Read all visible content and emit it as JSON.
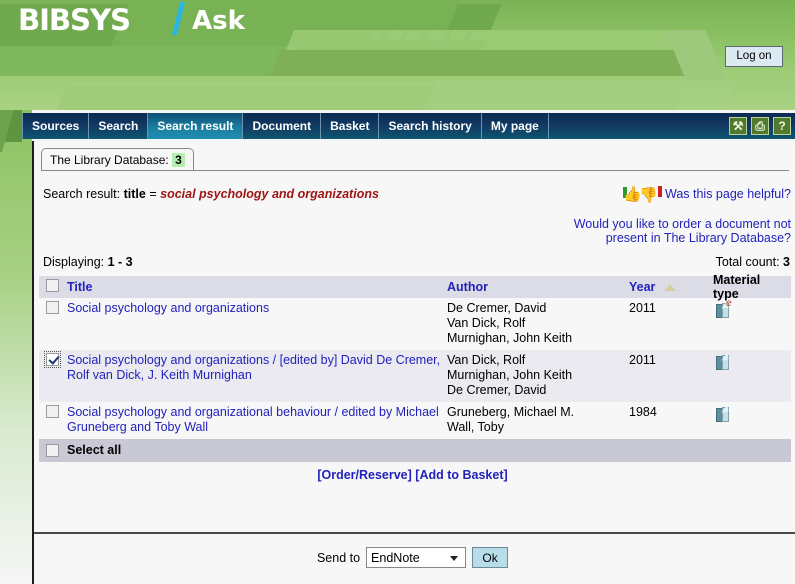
{
  "banner": {
    "logo": "BIBSYS",
    "app_name": "Ask",
    "logon_label": "Log on",
    "accent_cyan": "#29b6e0",
    "green": "#8cc162"
  },
  "nav": {
    "tabs": [
      {
        "label": "Sources",
        "active": false
      },
      {
        "label": "Search",
        "active": false
      },
      {
        "label": "Search result",
        "active": true
      },
      {
        "label": "Document",
        "active": false
      },
      {
        "label": "Basket",
        "active": false
      },
      {
        "label": "Search history",
        "active": false
      },
      {
        "label": "My page",
        "active": false
      }
    ],
    "icons": [
      {
        "name": "wrench-icon",
        "glyph": "⚒"
      },
      {
        "name": "printer-icon",
        "glyph": "⎙"
      },
      {
        "name": "help-icon",
        "glyph": "?"
      }
    ]
  },
  "database_tab": {
    "label": "The Library Database:",
    "count": "3"
  },
  "search": {
    "prefix": "Search result:",
    "field": "title",
    "equals": "=",
    "query": "social psychology and organizations"
  },
  "feedback": {
    "helpful_text": "Was this page helpful?",
    "order_text": "Would you like to order a document not present in The Library Database?"
  },
  "paging": {
    "displaying_label": "Displaying:",
    "displaying_range": "1 - 3",
    "total_label": "Total count:",
    "total_value": "3"
  },
  "table": {
    "columns": [
      {
        "label": "Title",
        "link": true
      },
      {
        "label": "Author",
        "link": true
      },
      {
        "label": "Year",
        "link": true,
        "sort": "asc"
      },
      {
        "label": "Material type",
        "link": false
      }
    ],
    "rows": [
      {
        "checked": false,
        "title": "Social psychology and organizations",
        "authors": [
          "De Cremer, David",
          "Van Dick, Rolf",
          "Murnighan, John Keith"
        ],
        "year": "2011",
        "material": "ebook-icon"
      },
      {
        "checked": true,
        "title": "Social psychology and organizations / [edited by] David De Cremer, Rolf van Dick, J. Keith Murnighan",
        "authors": [
          "Van Dick, Rolf",
          "Murnighan, John Keith",
          "De Cremer, David"
        ],
        "year": "2011",
        "material": "book-icon"
      },
      {
        "checked": false,
        "title": "Social psychology and organizational behaviour / edited by Michael Gruneberg and Toby Wall",
        "authors": [
          "Gruneberg, Michael M.",
          "Wall, Toby"
        ],
        "year": "1984",
        "material": "book-icon"
      }
    ],
    "select_all_label": "Select all",
    "select_all_checked": false
  },
  "actions": {
    "order_reserve": "[Order/Reserve]",
    "add_to_basket": "[Add to Basket]"
  },
  "footer": {
    "send_to_label": "Send to",
    "send_to_value": "EndNote",
    "ok_label": "Ok"
  }
}
